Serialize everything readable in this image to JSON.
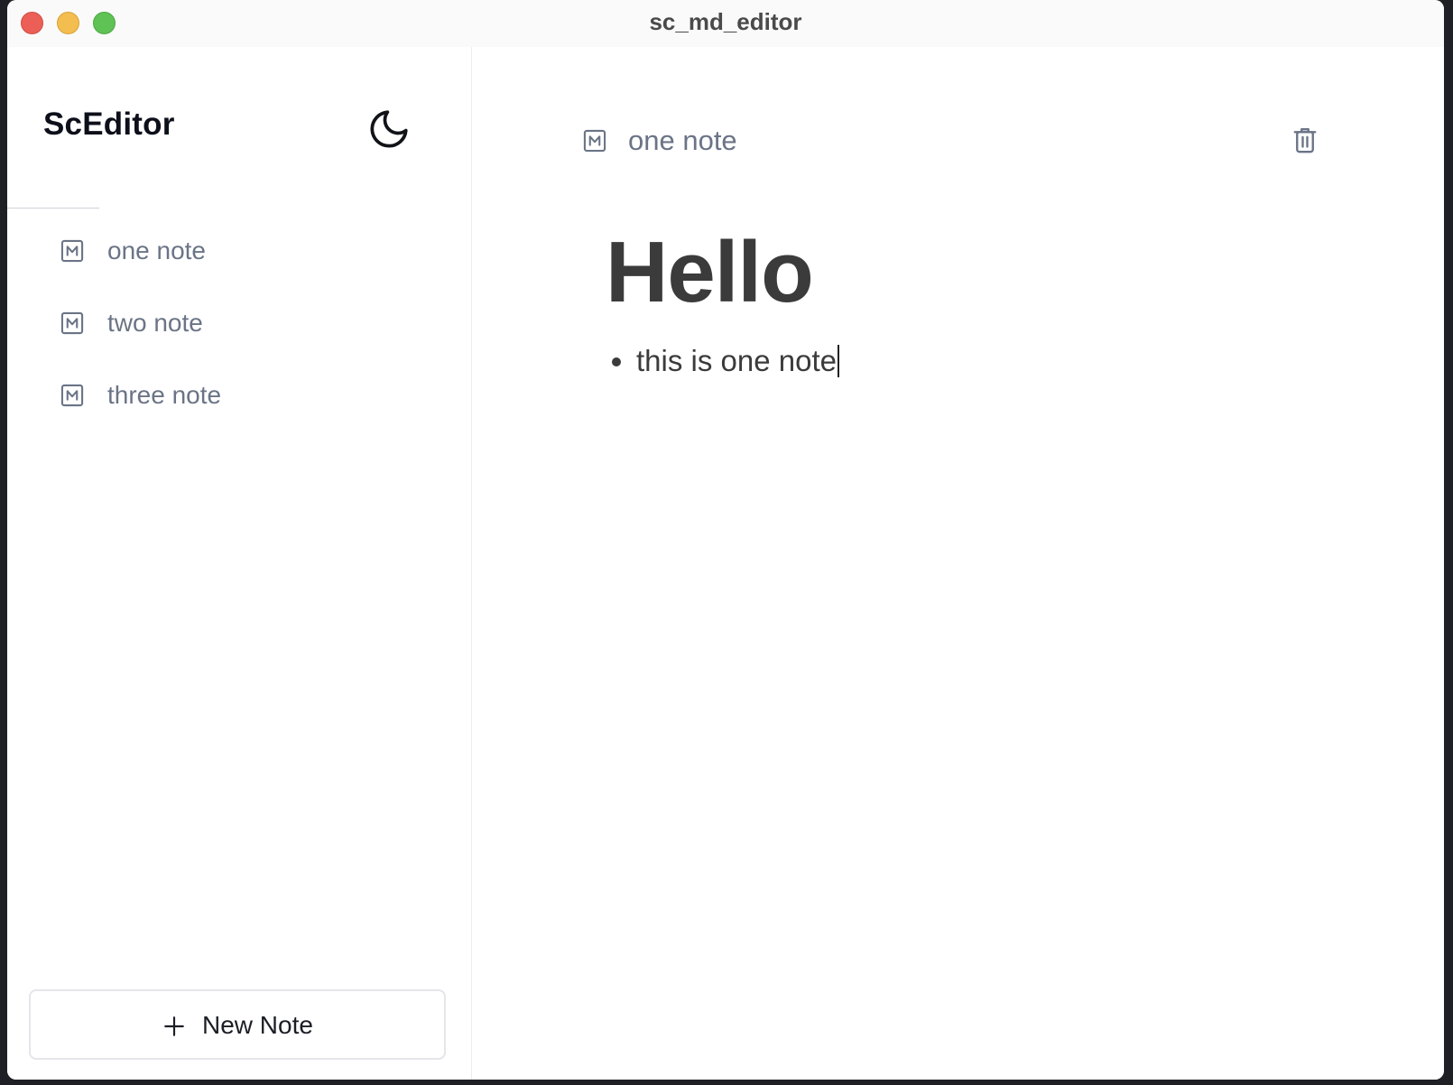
{
  "window": {
    "title": "sc_md_editor"
  },
  "sidebar": {
    "brand": "ScEditor",
    "theme_icon": "moon-icon",
    "notes": [
      {
        "label": "one note",
        "icon": "markdown-icon"
      },
      {
        "label": "two note",
        "icon": "markdown-icon"
      },
      {
        "label": "three note",
        "icon": "markdown-icon"
      }
    ],
    "new_note_label": "New Note"
  },
  "main": {
    "current_note_title": "one note",
    "delete_icon": "trash-icon",
    "content": {
      "heading": "Hello",
      "bullets": [
        "this is one note"
      ]
    }
  },
  "colors": {
    "muted_text": "#6b7486",
    "body_text": "#3b3b3b",
    "brand_text": "#0d0f1a"
  }
}
